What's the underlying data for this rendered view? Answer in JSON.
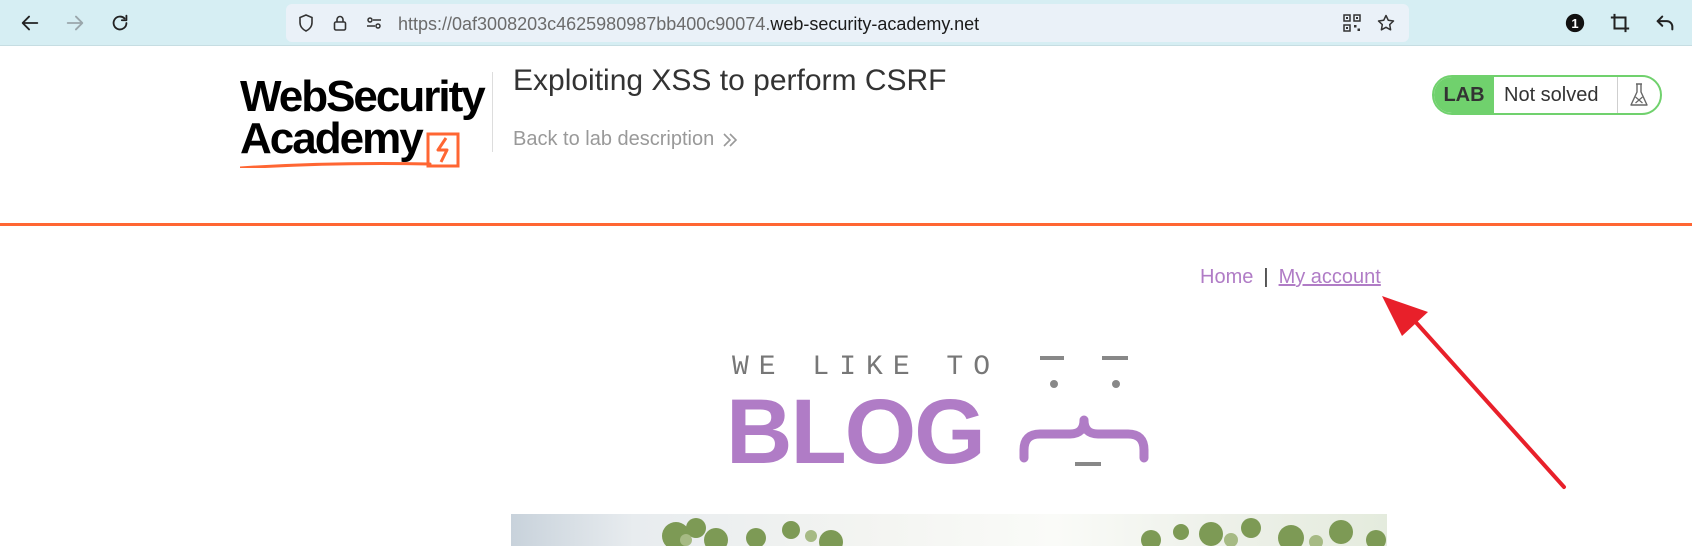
{
  "browser": {
    "url_prefix": "https://0af3008203c4625980987bb400c90074.",
    "url_domain": "web-security-academy.net",
    "notification_count": "1"
  },
  "lab": {
    "logo_line1": "WebSecurity",
    "logo_line2": "Academy",
    "title": "Exploiting XSS to perform CSRF",
    "back_link": "Back to lab description",
    "badge_label": "LAB",
    "status": "Not solved"
  },
  "blog_nav": {
    "home": "Home",
    "separator": "|",
    "account": "My account"
  },
  "banner": {
    "tagline": "WE LIKE TO",
    "word": "BLOG"
  },
  "colors": {
    "accent_orange": "#ff6633",
    "lab_green": "#70d16d",
    "blog_purple": "#b07cc6",
    "annotation_red": "#e8202a"
  }
}
